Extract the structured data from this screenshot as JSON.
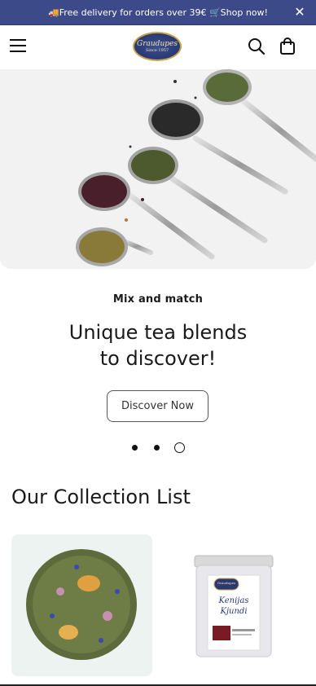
{
  "announcement": {
    "text": "🚚Free delivery for orders over 39€ 🛒Shop now!",
    "close_icon": "close-icon"
  },
  "header": {
    "menu_icon": "hamburger-menu-icon",
    "logo": {
      "name": "Graudupes",
      "tagline": "Since 1957"
    },
    "search_icon": "search-icon",
    "cart_icon": "shopping-bag-icon"
  },
  "hero": {
    "image": "tea-spoons-with-loose-leaf-blends",
    "eyebrow": "Mix and match",
    "headline_line1": "Unique tea blends",
    "headline_line2": "to discover!",
    "cta_label": "Discover Now",
    "slides": 3,
    "active_slide": 3
  },
  "collection": {
    "title": "Our Collection List",
    "items": [
      {
        "image": "loose-leaf-tea-blend-with-flowers"
      },
      {
        "image": "tea-tin-canister",
        "tin_brand": "Graudupes",
        "tin_label_1": "Kenijas",
        "tin_label_2": "Kjundi"
      }
    ]
  },
  "colors": {
    "announcement_bg": "#3d4a8a",
    "logo_gold": "#c9a34a",
    "card_bg": "#edf3f0"
  }
}
